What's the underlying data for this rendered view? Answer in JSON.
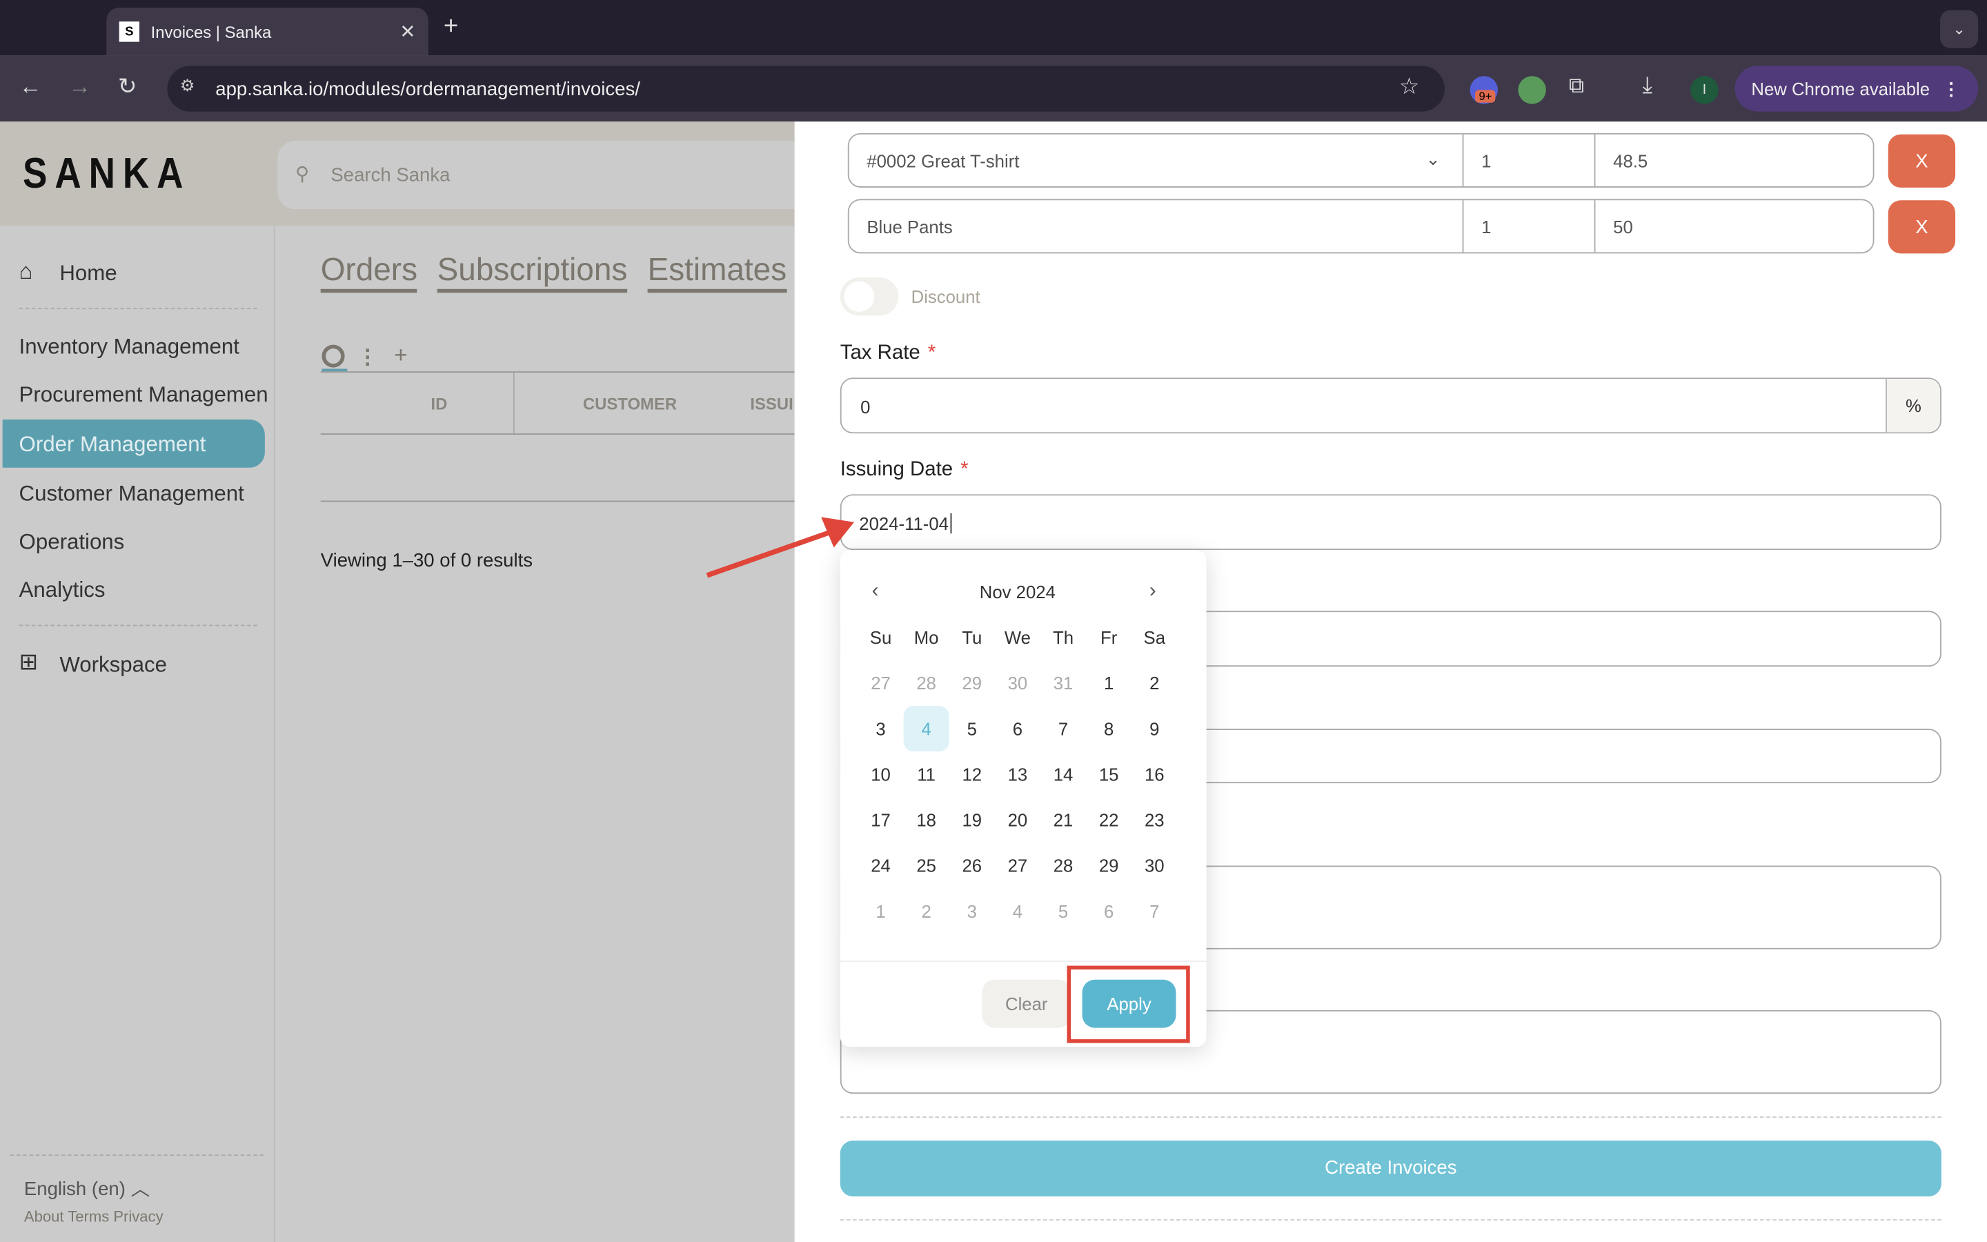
{
  "browser": {
    "tab_title": "Invoices | Sanka",
    "favicon": "S",
    "url": "app.sanka.io/modules/ordermanagement/invoices/",
    "extension_badge": "9+",
    "profile_initial": "I",
    "update_button": "New Chrome available"
  },
  "app": {
    "logo": "SANKA",
    "search_placeholder": "Search Sanka"
  },
  "sidebar": {
    "home": "Home",
    "items": [
      "Inventory Management",
      "Procurement Managemen",
      "Order Management",
      "Customer Management",
      "Operations",
      "Analytics"
    ],
    "active": "Order Management",
    "workspace": "Workspace",
    "language": "English (en)",
    "footer_links": "About Terms Privacy"
  },
  "main": {
    "tabs": [
      "Orders",
      "Subscriptions",
      "Estimates"
    ],
    "columns": [
      "ID",
      "CUSTOMER",
      "ISSUI"
    ],
    "results": "Viewing 1–30 of 0 results"
  },
  "form": {
    "line_items": [
      {
        "product": "#0002 Great T-shirt",
        "qty": "1",
        "price": "48.5",
        "remove": "X"
      },
      {
        "product": "Blue Pants",
        "qty": "1",
        "price": "50",
        "remove": "X"
      }
    ],
    "discount_label": "Discount",
    "discount_on": false,
    "tax_rate_label": "Tax Rate",
    "tax_rate_value": "0",
    "tax_unit": "%",
    "required_mark": "*",
    "issuing_date_label": "Issuing Date",
    "issuing_date_value": "2024-11-04",
    "submit": "Create Invoices"
  },
  "calendar": {
    "month": "Nov 2024",
    "weekdays": [
      "Su",
      "Mo",
      "Tu",
      "We",
      "Th",
      "Fr",
      "Sa"
    ],
    "days": [
      "27",
      "28",
      "29",
      "30",
      "31",
      "1",
      "2",
      "3",
      "4",
      "5",
      "6",
      "7",
      "8",
      "9",
      "10",
      "11",
      "12",
      "13",
      "14",
      "15",
      "16",
      "17",
      "18",
      "19",
      "20",
      "21",
      "22",
      "23",
      "24",
      "25",
      "26",
      "27",
      "28",
      "29",
      "30",
      "1",
      "2",
      "3",
      "4",
      "5",
      "6",
      "7"
    ],
    "selected": "4",
    "clear": "Clear",
    "apply": "Apply"
  },
  "colors": {
    "accent": "#5bb7cf",
    "danger": "#e06c4f",
    "annotation": "#e0453a"
  }
}
